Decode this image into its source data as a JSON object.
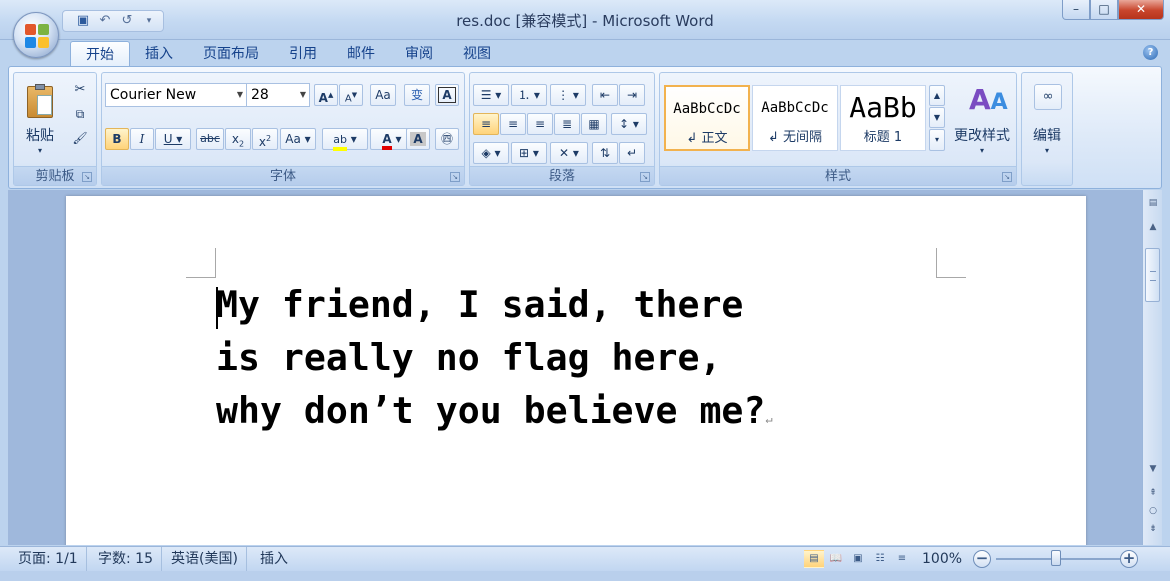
{
  "window": {
    "title": "res.doc [兼容模式] - Microsoft Word",
    "controls": {
      "minimize": "–",
      "maximize": "□",
      "close": "✕"
    }
  },
  "quick_access": {
    "save_icon": "save-icon",
    "undo_icon": "undo-icon",
    "repeat_icon": "repeat-icon",
    "customize_icon": "chevron-down-icon"
  },
  "ribbon_tabs": [
    "开始",
    "插入",
    "页面布局",
    "引用",
    "邮件",
    "审阅",
    "视图"
  ],
  "active_tab": "开始",
  "groups": {
    "clipboard": {
      "label": "剪贴板",
      "paste": "粘贴"
    },
    "font": {
      "label": "字体",
      "font_name": "Courier New",
      "font_size": "28"
    },
    "paragraph": {
      "label": "段落"
    },
    "styles": {
      "label": "样式",
      "tiles": [
        {
          "sample": "AaBbCcDc",
          "name": "↲ 正文"
        },
        {
          "sample": "AaBbCcDc",
          "name": "↲ 无间隔"
        },
        {
          "sample": "AaBb",
          "name": "标题 1"
        }
      ],
      "change_styles": "更改样式"
    },
    "editing": {
      "label": "编辑"
    }
  },
  "document": {
    "text": "My friend, I said, there\nis really no flag here,\nwhy don’t you believe me?",
    "paragraph_mark": "↵"
  },
  "status": {
    "page": "页面: 1/1",
    "words": "字数: 15",
    "language": "英语(美国)",
    "mode": "插入",
    "zoom": "100%",
    "zoom_level": 100
  },
  "colors": {
    "highlight": "#ffff00",
    "font_color": "#e00000",
    "active_style_border": "#f2b24e"
  }
}
